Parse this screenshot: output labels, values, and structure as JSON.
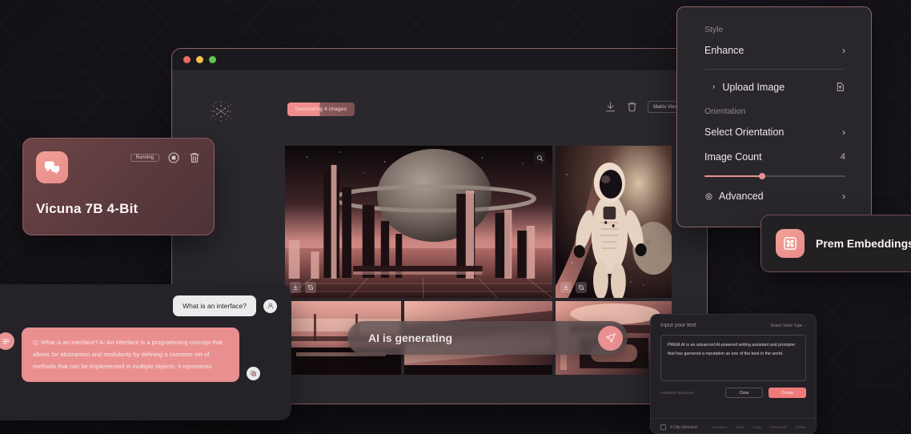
{
  "background": {
    "base_color": "#15131a",
    "accent_color": "#e99090"
  },
  "browser_window": {
    "traffic_lights": [
      "close-red",
      "minimize-yellow",
      "maximize-green"
    ],
    "logo_icon": "prem-particles-logo-icon",
    "generating_pill": "Generating 4 images",
    "toolbar": {
      "download_icon": "download-icon",
      "delete_icon": "trash-icon",
      "view_select_label": "Matrix View",
      "view_select_chevron": "▾"
    },
    "gallery": {
      "tiles": [
        {
          "name": "sci-fi-city-planet",
          "zoom_icon": "magnifier-icon",
          "tools": [
            "download-icon",
            "regenerate-icon"
          ]
        },
        {
          "name": "astronaut-space",
          "tools": [
            "download-icon",
            "regenerate-icon"
          ]
        },
        {
          "name": "corridor-thumb",
          "tools": []
        },
        {
          "name": "structure-thumb",
          "tools": []
        },
        {
          "name": "machinery-thumb",
          "tools": []
        }
      ]
    },
    "prompt_bar": {
      "status_text": "AI is generating",
      "send_icon": "send-icon"
    }
  },
  "model_card": {
    "icon": "chat-bubbles-icon",
    "status_badge": "Running",
    "stop_icon": "stop-circle-icon",
    "delete_icon": "trash-icon",
    "title": "Vicuna 7B 4-Bit"
  },
  "chat_panel": {
    "user_message": "What is an interface?",
    "user_avatar_icon": "user-avatar-icon",
    "ai_avatar_icon": "ai-assistant-icon",
    "ai_message": "Q: What is an interface? A: An interface is a programming concept that allows for abstraction and modularity by defining a common set of methods that can be implemented in multiple objects. It represents",
    "copy_icon": "copy-icon"
  },
  "settings_panel": {
    "style_label": "Style",
    "enhance_label": "Enhance",
    "enhance_chevron": "›",
    "upload_label": "Upload Image",
    "upload_chevron": "›",
    "upload_icon": "upload-file-icon",
    "orientation_label": "Orientation",
    "select_orientation_label": "Select Orientation",
    "select_orientation_chevron": "›",
    "image_count_label": "Image Count",
    "image_count_value": "4",
    "slider_percent": 41,
    "advanced_label": "Advanced",
    "advanced_icon": "settings-eye-icon",
    "advanced_chevron": "›"
  },
  "embeddings_card": {
    "icon": "embeddings-grid-icon",
    "title": "Prem Embeddings"
  },
  "tts_panel": {
    "input_label": "Input your text",
    "voice_select_label": "Select Voice Type",
    "voice_select_chevron": "›",
    "text_value": "PREM.AI is an advanced AI-powered writing assistant and prompter that has garnered a reputation as one of the best in the world.",
    "char_counter": "049/5000 characters",
    "clear_button": "Clear",
    "create_button": "Create",
    "selection_label": "0 Clip Selected",
    "links": [
      "Combine",
      "Mute",
      "Copy",
      "Download",
      "Delete"
    ]
  }
}
